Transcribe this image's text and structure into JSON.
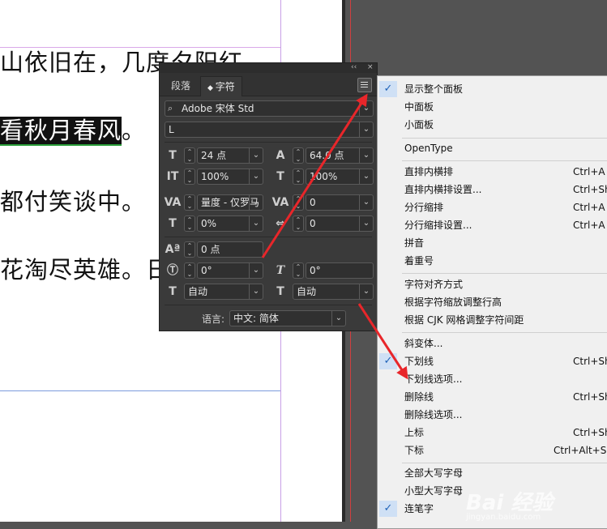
{
  "document": {
    "lines": [
      "山依旧在，几度夕阳红",
      "看秋月春风",
      "。",
      "都付笑谈中。",
      "花淘尽英雄。日"
    ]
  },
  "panel": {
    "tabs": [
      "段落",
      "字符"
    ],
    "strip_glyphs": [
      "‹‹",
      "×"
    ],
    "font_family": "Adobe 宋体 Std",
    "font_style": "L",
    "font_size": "24 点",
    "leading": "64.0 点",
    "vertical_scale": "100%",
    "horizontal_scale": "100%",
    "kerning": "量度 - 仅罗马",
    "tracking": "0",
    "tsume": "0%",
    "aki": "0",
    "baseline_shift": "0 点",
    "rotation": "0°",
    "skew": "0°",
    "align_left": "自动",
    "align_right": "自动",
    "language_label": "语言:",
    "language_value": "中文: 简体"
  },
  "menu": {
    "items": [
      {
        "label": "显示整个面板",
        "shortcut": "",
        "checked": true
      },
      {
        "label": "中面板",
        "shortcut": "",
        "checked": false
      },
      {
        "label": "小面板",
        "shortcut": "",
        "checked": false
      },
      {
        "label": "OpenType",
        "shortcut": "",
        "checked": false
      },
      {
        "label": "直排内横排",
        "shortcut": "Ctrl+A",
        "checked": false
      },
      {
        "label": "直排内横排设置...",
        "shortcut": "Ctrl+Sh",
        "checked": false
      },
      {
        "label": "分行缩排",
        "shortcut": "Ctrl+A",
        "checked": false
      },
      {
        "label": "分行缩排设置...",
        "shortcut": "Ctrl+A",
        "checked": false
      },
      {
        "label": "拼音",
        "shortcut": "",
        "checked": false
      },
      {
        "label": "着重号",
        "shortcut": "",
        "checked": false
      },
      {
        "label": "字符对齐方式",
        "shortcut": "",
        "checked": false
      },
      {
        "label": "根据字符缩放调整行高",
        "shortcut": "",
        "checked": false
      },
      {
        "label": "根据 CJK 网格调整字符间距",
        "shortcut": "",
        "checked": false
      },
      {
        "label": "斜变体...",
        "shortcut": "",
        "checked": false
      },
      {
        "label": "下划线",
        "shortcut": "Ctrl+Sh",
        "checked": true
      },
      {
        "label": "下划线选项...",
        "shortcut": "",
        "checked": false
      },
      {
        "label": "删除线",
        "shortcut": "Ctrl+Sh",
        "checked": false
      },
      {
        "label": "删除线选项...",
        "shortcut": "",
        "checked": false
      },
      {
        "label": "上标",
        "shortcut": "Ctrl+Sh",
        "checked": false
      },
      {
        "label": "下标",
        "shortcut": "Ctrl+Alt+Sh",
        "checked": false
      },
      {
        "label": "全部大写字母",
        "shortcut": "",
        "checked": false
      },
      {
        "label": "小型大写字母",
        "shortcut": "",
        "checked": false
      },
      {
        "label": "连笔字",
        "shortcut": "",
        "checked": true
      }
    ]
  },
  "colors": {
    "arrow": "#e8262a",
    "check_bg": "#cfe0f5",
    "check_mark": "#2063b8"
  },
  "watermark": {
    "text": "Bai 经验",
    "url": "jingyan.baidu.com"
  }
}
